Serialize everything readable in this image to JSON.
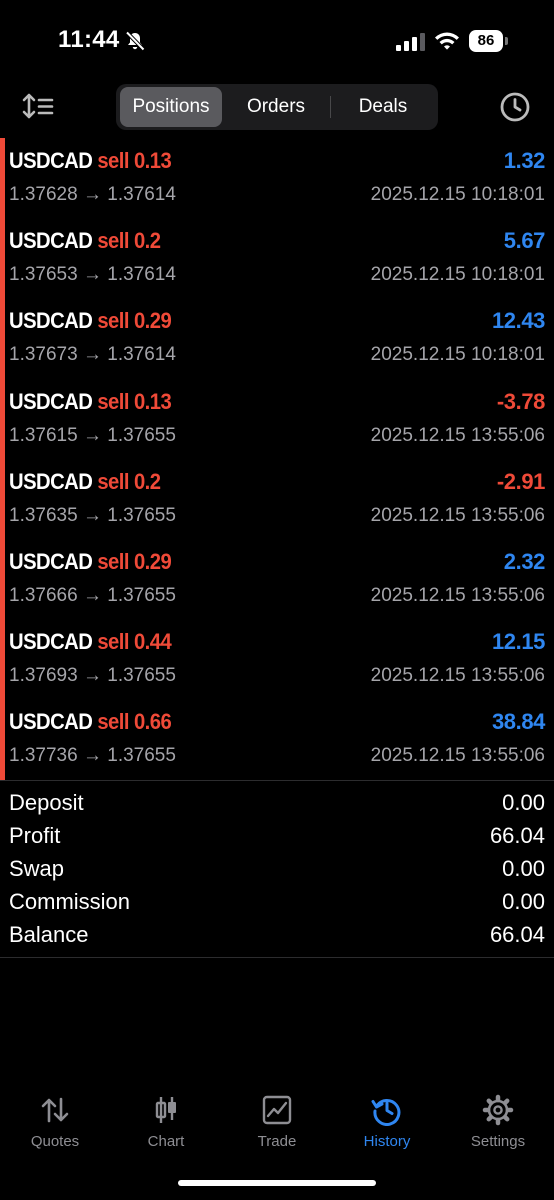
{
  "status_bar": {
    "time": "11:44",
    "battery": "86"
  },
  "tabs_top": [
    {
      "label": "Positions",
      "active": true
    },
    {
      "label": "Orders",
      "active": false
    },
    {
      "label": "Deals",
      "active": false
    }
  ],
  "positions": [
    {
      "symbol": "USDCAD",
      "side": "sell",
      "volume": "0.13",
      "open": "1.37628",
      "arrow": "→",
      "close": "1.37614",
      "time": "2025.12.15 10:18:01",
      "profit": "1.32"
    },
    {
      "symbol": "USDCAD",
      "side": "sell",
      "volume": "0.2",
      "open": "1.37653",
      "arrow": "→",
      "close": "1.37614",
      "time": "2025.12.15 10:18:01",
      "profit": "5.67"
    },
    {
      "symbol": "USDCAD",
      "side": "sell",
      "volume": "0.29",
      "open": "1.37673",
      "arrow": "→",
      "close": "1.37614",
      "time": "2025.12.15 10:18:01",
      "profit": "12.43"
    },
    {
      "symbol": "USDCAD",
      "side": "sell",
      "volume": "0.13",
      "open": "1.37615",
      "arrow": "→",
      "close": "1.37655",
      "time": "2025.12.15 13:55:06",
      "profit": "-3.78"
    },
    {
      "symbol": "USDCAD",
      "side": "sell",
      "volume": "0.2",
      "open": "1.37635",
      "arrow": "→",
      "close": "1.37655",
      "time": "2025.12.15 13:55:06",
      "profit": "-2.91"
    },
    {
      "symbol": "USDCAD",
      "side": "sell",
      "volume": "0.29",
      "open": "1.37666",
      "arrow": "→",
      "close": "1.37655",
      "time": "2025.12.15 13:55:06",
      "profit": "2.32"
    },
    {
      "symbol": "USDCAD",
      "side": "sell",
      "volume": "0.44",
      "open": "1.37693",
      "arrow": "→",
      "close": "1.37655",
      "time": "2025.12.15 13:55:06",
      "profit": "12.15"
    },
    {
      "symbol": "USDCAD",
      "side": "sell",
      "volume": "0.66",
      "open": "1.37736",
      "arrow": "→",
      "close": "1.37655",
      "time": "2025.12.15 13:55:06",
      "profit": "38.84"
    }
  ],
  "summary": [
    {
      "label": "Deposit",
      "value": "0.00"
    },
    {
      "label": "Profit",
      "value": "66.04"
    },
    {
      "label": "Swap",
      "value": "0.00"
    },
    {
      "label": "Commission",
      "value": "0.00"
    },
    {
      "label": "Balance",
      "value": "66.04"
    }
  ],
  "tabbar": [
    {
      "label": "Quotes",
      "icon": "arrows-updown-icon",
      "active": false
    },
    {
      "label": "Chart",
      "icon": "candlestick-icon",
      "active": false
    },
    {
      "label": "Trade",
      "icon": "trade-chart-icon",
      "active": false
    },
    {
      "label": "History",
      "icon": "history-icon",
      "active": true
    },
    {
      "label": "Settings",
      "icon": "gear-icon",
      "active": false
    }
  ],
  "colors": {
    "accent_blue": "#2f86f0",
    "loss_red": "#ef4a38",
    "background": "#000000",
    "muted_gray": "#a5a5aa"
  }
}
